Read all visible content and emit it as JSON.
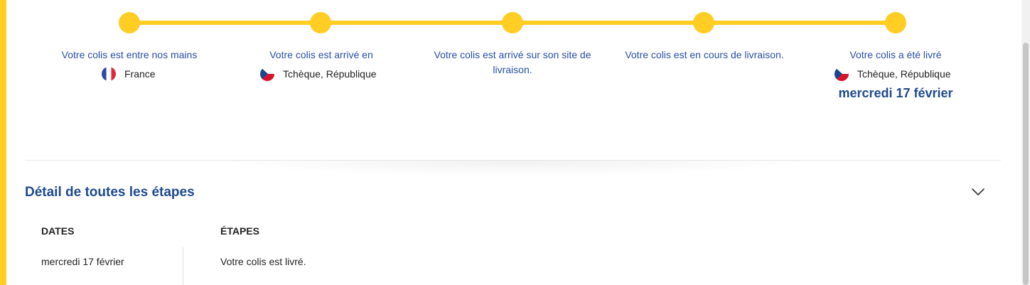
{
  "timeline": {
    "steps": [
      {
        "label": "Votre colis est entre nos mains",
        "country": "France",
        "flag": "flag-france-icon"
      },
      {
        "label": "Votre colis est arrivé en",
        "country": "Tchèque, République",
        "flag": "flag-czech-icon"
      },
      {
        "label": "Votre colis est arrivé sur son site de livraison."
      },
      {
        "label": "Votre colis est en cours de livraison."
      },
      {
        "label": "Votre colis a été livré",
        "country": "Tchèque, République",
        "flag": "flag-czech-icon",
        "date": "mercredi 17 février"
      }
    ],
    "progress": 1.0
  },
  "details": {
    "title": "Détail de toutes les étapes",
    "toggle_icon": "chevron-down-icon",
    "columns": {
      "dates": "DATES",
      "steps": "ÉTAPES"
    },
    "rows": [
      {
        "date": "mercredi 17 février",
        "step": "Votre colis est livré."
      }
    ]
  },
  "colors": {
    "accent": "#ffcd24",
    "link_blue": "#2a4fa2",
    "title_blue": "#1f4a8c",
    "text": "#222222"
  }
}
